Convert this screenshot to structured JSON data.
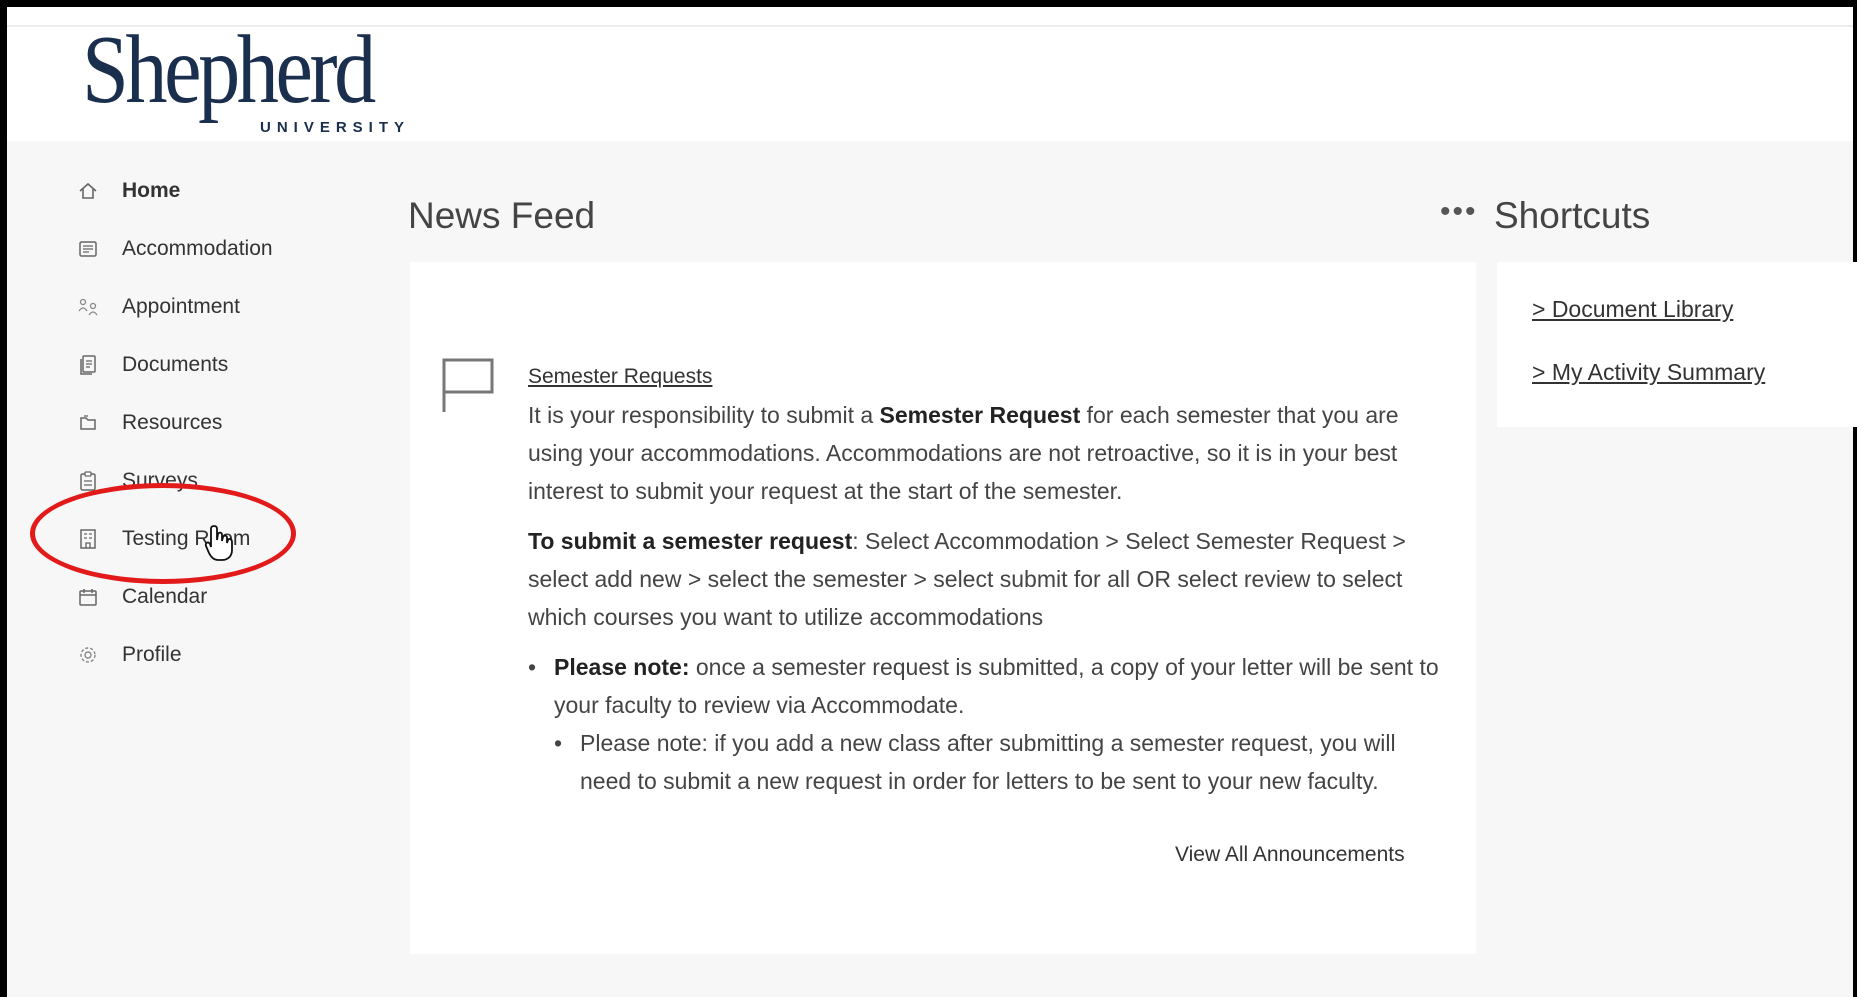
{
  "logo": {
    "wordmark": "Shepherd",
    "subtitle": "UNIVERSITY"
  },
  "sidebar": {
    "items": [
      {
        "label": "Home",
        "icon": "home-icon"
      },
      {
        "label": "Accommodation",
        "icon": "list-icon"
      },
      {
        "label": "Appointment",
        "icon": "people-icon"
      },
      {
        "label": "Documents",
        "icon": "document-icon"
      },
      {
        "label": "Resources",
        "icon": "folder-icon"
      },
      {
        "label": "Surveys",
        "icon": "clipboard-icon"
      },
      {
        "label": "Testing Room",
        "icon": "building-icon"
      },
      {
        "label": "Calendar",
        "icon": "calendar-icon"
      },
      {
        "label": "Profile",
        "icon": "gear-icon"
      }
    ]
  },
  "news_feed": {
    "title": "News Feed",
    "more": "•••",
    "announcement": {
      "link": "Semester Requests",
      "para1_pre": "It is your responsibility to submit a ",
      "para1_bold": "Semester Request",
      "para1_post": " for each semester that you are using your accommodations. Accommodations are not retroactive, so it is in your best interest to submit your request at the start of the semester.",
      "para2_bold": "To submit a semester request",
      "para2_post": ":  Select Accommodation > Select Semester Request > select add new > select the semester > select submit for all OR select review to select which courses you want to utilize accommodations",
      "note1_bold": "Please note:",
      "note1_post": " once a semester request is submitted, a copy of your letter will be sent to your faculty to review via Accommodate.",
      "note2": "Please note: if you add a new class after submitting a semester request, you will need to submit a new request in order for letters to be sent to your new faculty."
    },
    "view_all": "View All Announcements"
  },
  "shortcuts": {
    "title": "Shortcuts",
    "links": [
      "> Document Library",
      "> My Activity Summary"
    ]
  },
  "colors": {
    "brand": "#1a2e4d",
    "highlight": "#e21a1a"
  }
}
